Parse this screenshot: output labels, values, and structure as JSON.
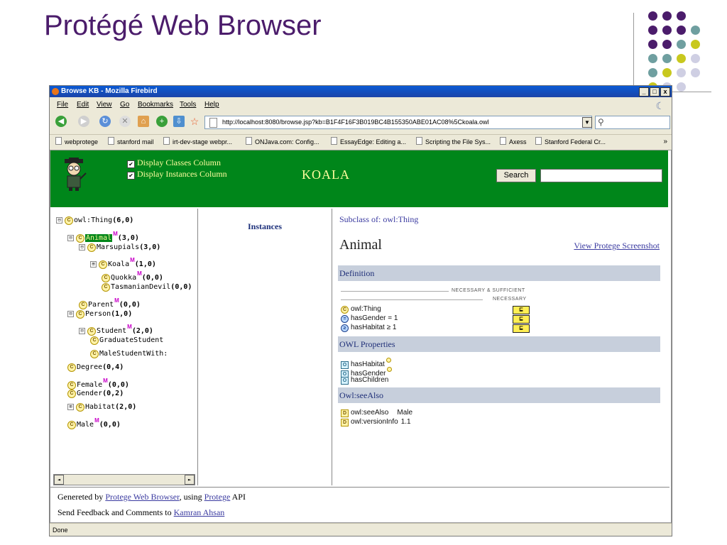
{
  "slide": {
    "title": "Protégé Web Browser"
  },
  "window": {
    "title": "Browse KB - Mozilla Firebird",
    "menu": [
      "File",
      "Edit",
      "View",
      "Go",
      "Bookmarks",
      "Tools",
      "Help"
    ],
    "url": "http://localhost:8080/browse.jsp?kb=B1F4F16F3B019BC4B155350ABE01AC08%5Ckoala.owl",
    "bookmarks": [
      "webprotege",
      "stanford mail",
      "irt-dev-stage webpr...",
      "ONJava.com: Config...",
      "EssayEdge: Editing a...",
      "Scripting the File Sys...",
      "Axess",
      "Stanford Federal Cr..."
    ],
    "bookmarks_more": "»",
    "status": "Done",
    "controls": {
      "minimize": "_",
      "maximize": "□",
      "close": "x"
    }
  },
  "header": {
    "check_classes": "Display Classes Column",
    "check_instances": "Display Instances Column",
    "kb_name": "KOALA",
    "search_button": "Search",
    "check_mark": "✔"
  },
  "tree": {
    "nodes": [
      {
        "label": "owl:Thing",
        "count": "(6,0)",
        "expander": "⊟",
        "m": ""
      },
      {
        "label": "Animal",
        "count": "(3,0)",
        "expander": "⊟",
        "m": "M"
      },
      {
        "label": "Marsupials",
        "count": "(3,0)",
        "expander": "⊟",
        "m": ""
      },
      {
        "label": "Koala",
        "count": "(1,0)",
        "expander": "⊞",
        "m": "M"
      },
      {
        "label": "Quokka",
        "count": "(0,0)",
        "expander": "",
        "m": "M"
      },
      {
        "label": "TasmanianDevil",
        "count": "(0,0)",
        "expander": "",
        "m": ""
      },
      {
        "label": "Parent",
        "count": "(0,0)",
        "expander": "",
        "m": "M"
      },
      {
        "label": "Person",
        "count": "(1,0)",
        "expander": "⊟",
        "m": ""
      },
      {
        "label": "Student",
        "count": "(2,0)",
        "expander": "⊟",
        "m": "M"
      },
      {
        "label": "GraduateStudent",
        "count": "",
        "expander": "",
        "m": ""
      },
      {
        "label": "MaleStudentWith:",
        "count": "",
        "expander": "",
        "m": ""
      },
      {
        "label": "Degree",
        "count": "(0,4)",
        "expander": "",
        "m": ""
      },
      {
        "label": "Female",
        "count": "(0,0)",
        "expander": "",
        "m": "M"
      },
      {
        "label": "Gender",
        "count": "(0,2)",
        "expander": "",
        "m": ""
      },
      {
        "label": "Habitat",
        "count": "(2,0)",
        "expander": "⊞",
        "m": ""
      },
      {
        "label": "Male",
        "count": "(0,0)",
        "expander": "",
        "m": "M"
      }
    ],
    "class_icon": "C",
    "scroll_left": "◄",
    "scroll_right": "►"
  },
  "instances": {
    "title": "Instances"
  },
  "detail": {
    "subclass_of": "Subclass of: owl:Thing",
    "class_name": "Animal",
    "view_screenshot": "View Protege Screenshot",
    "definition_title": "Definition",
    "necessary_sufficient": "NECESSARY & SUFFICIENT",
    "necessary": "NECESSARY",
    "axioms": [
      {
        "icon": "C",
        "text": "owl:Thing"
      },
      {
        "icon": "=",
        "text": "hasGender = 1"
      },
      {
        "icon": "≥",
        "text": "hasHabitat ≥ 1"
      }
    ],
    "subset_symbol": "⊑",
    "owl_properties_title": "OWL Properties",
    "properties": [
      "hasHabitat",
      "hasGender",
      "hasChildren"
    ],
    "prop_icon": "O",
    "seealso_title": "Owl:seeAlso",
    "annotations": [
      {
        "key": "owl:seeAlso",
        "value": "Male"
      },
      {
        "key": "owl:versionInfo",
        "value": "1.1"
      }
    ],
    "annot_icon": "D"
  },
  "footer": {
    "gen_prefix": "Genereted by",
    "browser_link": "Protege Web Browser",
    "using": ", using",
    "protege_link": "Protege",
    "api": "API",
    "feedback_prefix": "Send Feedback and Comments to",
    "author_link": "Kamran Ahsan"
  }
}
